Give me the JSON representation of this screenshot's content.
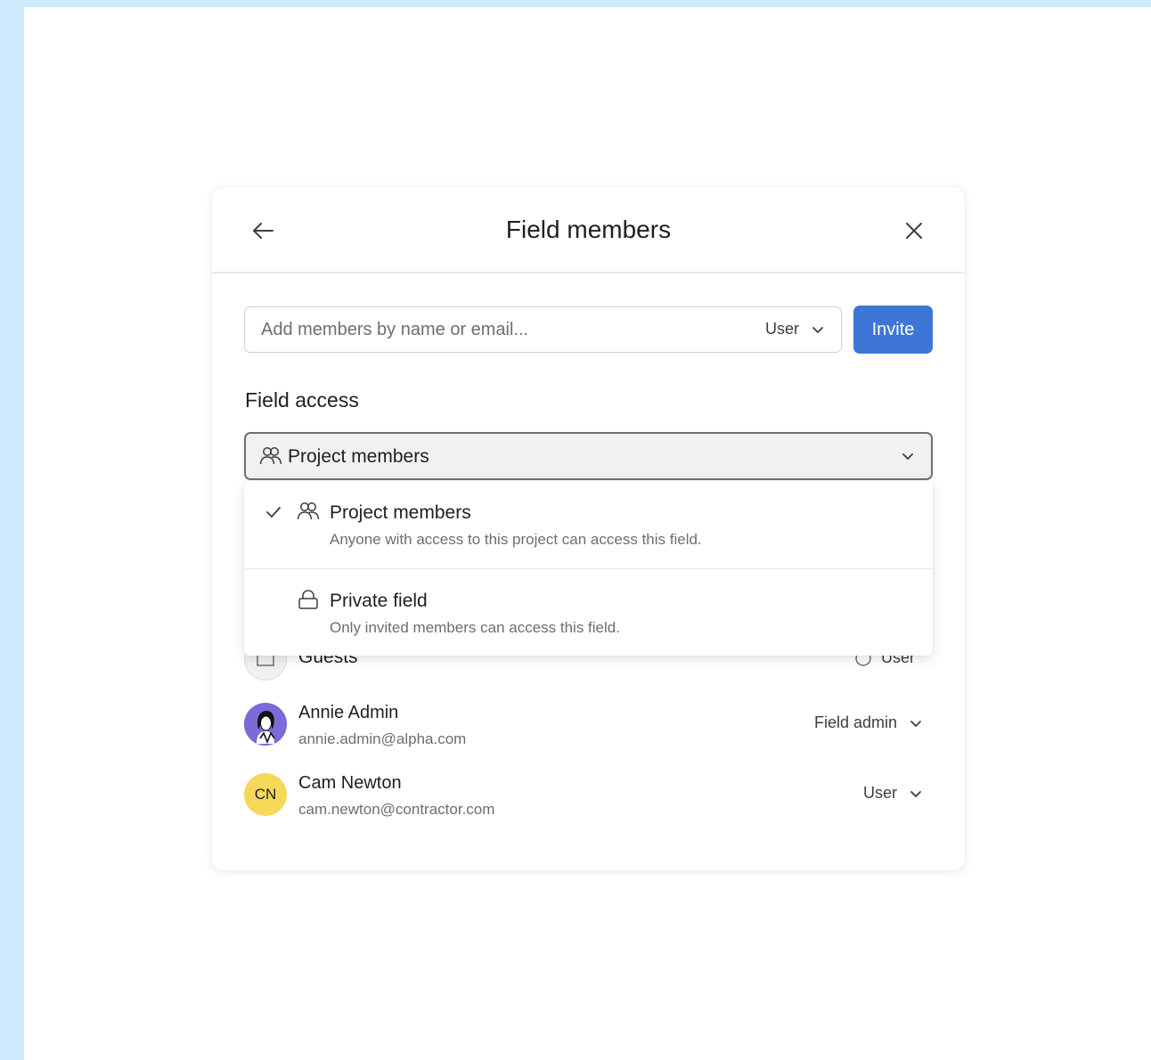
{
  "dialog": {
    "title": "Field members",
    "back_icon": "arrow-left-icon",
    "close_icon": "close-icon"
  },
  "invite": {
    "placeholder": "Add members by name or email...",
    "role": "User",
    "button_label": "Invite",
    "button_color": "#3d76d6"
  },
  "field_access": {
    "label": "Field access",
    "selected": "Project members",
    "options": [
      {
        "title": "Project members",
        "description": "Anyone with access to this project can access this field.",
        "icon": "people-icon",
        "checked": true
      },
      {
        "title": "Private field",
        "description": "Only invited members can access this field.",
        "icon": "lock-icon",
        "checked": false
      }
    ]
  },
  "members": {
    "guests": {
      "name": "Guests",
      "role": "User"
    },
    "list": [
      {
        "name": "Annie Admin",
        "email": "annie.admin@alpha.com",
        "role": "Field admin",
        "avatar_color": "#7b6bd8"
      },
      {
        "name": "Cam Newton",
        "email": "cam.newton@contractor.com",
        "role": "User",
        "initials": "CN",
        "avatar_color": "#f5d85a"
      }
    ]
  }
}
